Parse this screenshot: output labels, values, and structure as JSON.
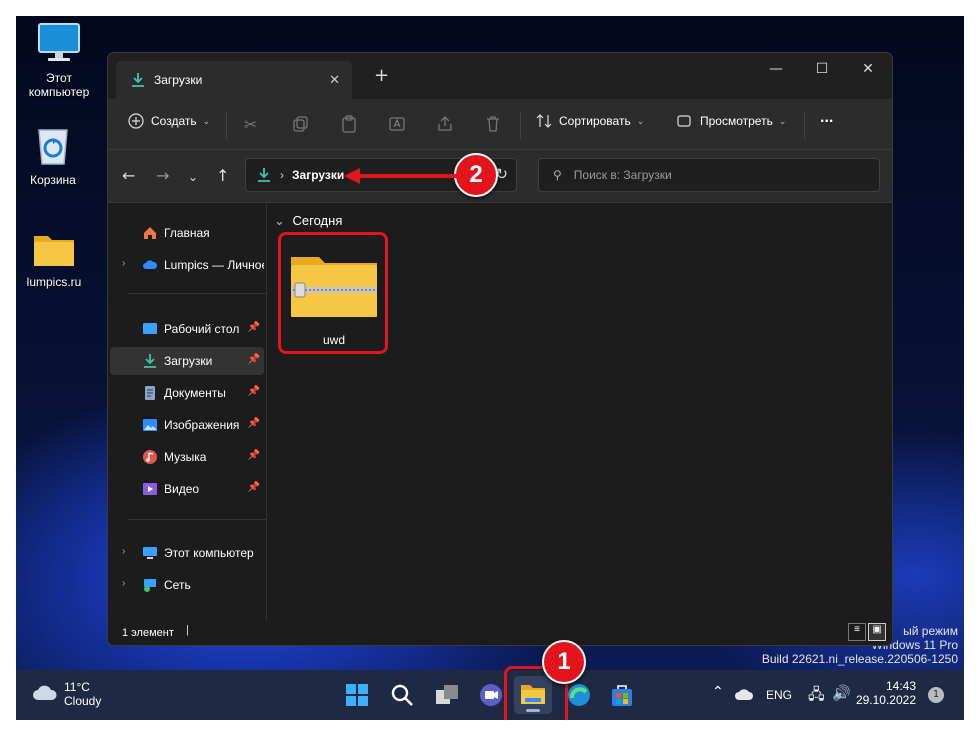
{
  "desktop": {
    "icons": [
      {
        "label_line1": "Этот",
        "label_line2": "компьютер",
        "icon": "monitor-icon"
      },
      {
        "label_line1": "Корзина",
        "icon": "recycle-bin-icon"
      },
      {
        "label_line1": "lumpics.ru",
        "icon": "folder-icon"
      }
    ]
  },
  "window": {
    "tab_title": "Загрузки",
    "tab_icon": "download-icon",
    "toolbar": {
      "create_label": "Создать",
      "sort_label": "Сортировать",
      "view_label": "Просмотреть",
      "more_label": "..."
    },
    "address": {
      "separator": "›",
      "current_folder": "Загрузки"
    },
    "search": {
      "placeholder": "Поиск в: Загрузки"
    },
    "sidebar": {
      "home": "Главная",
      "cloud": "Lumpics — Личное",
      "quick": [
        {
          "label": "Рабочий стол",
          "icon": "desktop-icon",
          "color": "#3aa0ff"
        },
        {
          "label": "Загрузки",
          "icon": "download-icon",
          "color": "#3ec5a8"
        },
        {
          "label": "Документы",
          "icon": "document-icon",
          "color": "#8aa4c8"
        },
        {
          "label": "Изображения",
          "icon": "image-icon",
          "color": "#2f8cff"
        },
        {
          "label": "Музыка",
          "icon": "music-icon",
          "color": "#e0584c"
        },
        {
          "label": "Видео",
          "icon": "video-icon",
          "color": "#8a5ce0"
        }
      ],
      "this_pc": "Этот компьютер",
      "network": "Сеть"
    },
    "content": {
      "group_label": "Сегодня",
      "files": [
        {
          "name": "uwd",
          "type": "zip-folder"
        }
      ]
    },
    "status": {
      "count_text": "1 элемент"
    }
  },
  "watermark": {
    "line1": "ый режим",
    "line2": "Windows 11 Pro",
    "line3": "Build 22621.ni_release.220506-1250"
  },
  "taskbar": {
    "weather_temp": "11°C",
    "weather_desc": "Cloudy",
    "lang": "ENG",
    "time": "14:43",
    "date": "29.10.2022",
    "notification_count": "1"
  },
  "annotations": {
    "step1": "1",
    "step2": "2"
  },
  "colors": {
    "accent": "#3ec5a8",
    "highlight": "#e3141b",
    "folder": "#f6c744"
  }
}
